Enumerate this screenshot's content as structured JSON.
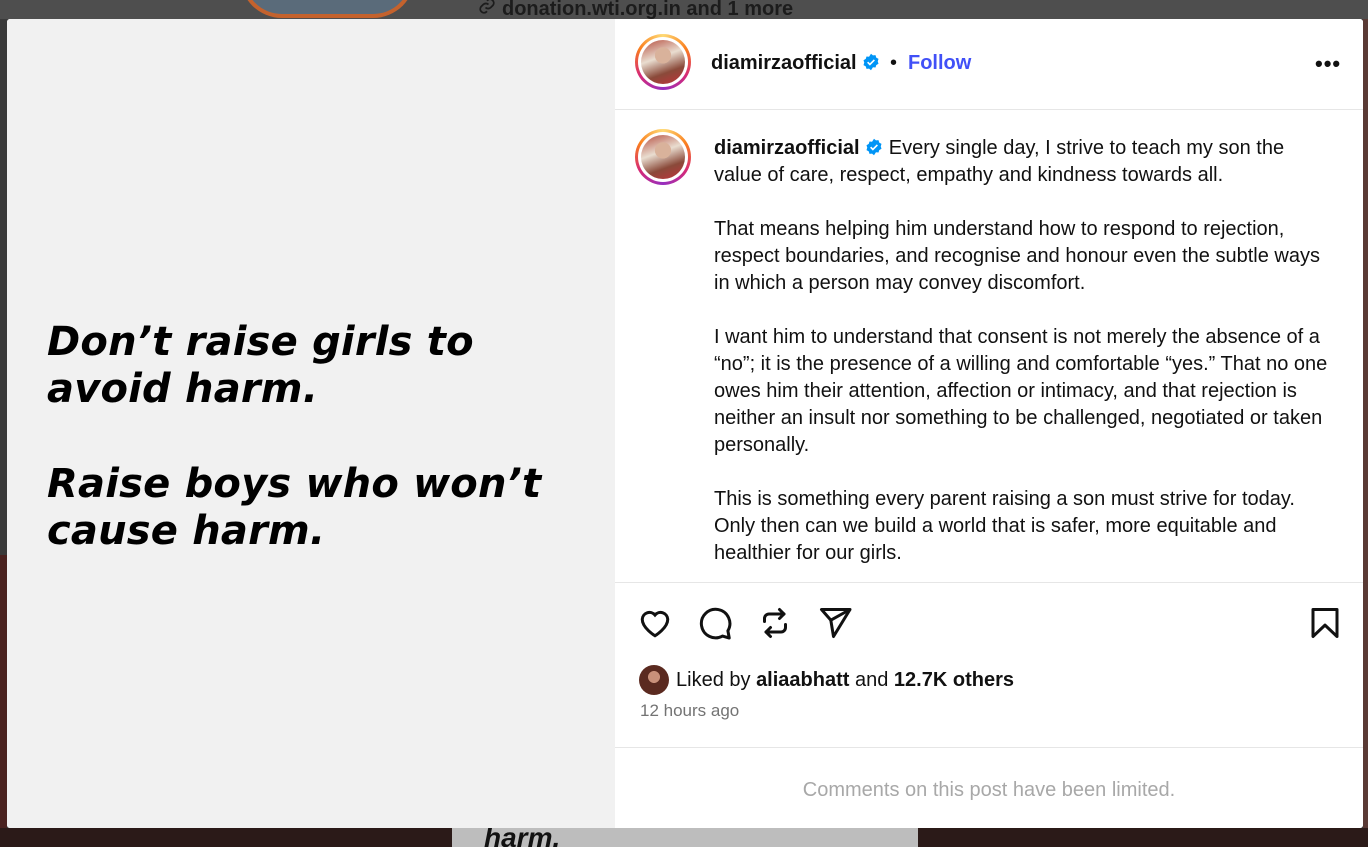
{
  "background": {
    "link_text": "donation.wti.org.in and 1 more",
    "bottom_text": "harm."
  },
  "media": {
    "quote_lines": [
      "Don’t raise girls to avoid harm.",
      "Raise boys who won’t cause harm."
    ]
  },
  "header": {
    "username": "diamirzaofficial",
    "separator": "•",
    "follow_label": "Follow",
    "more_label": "•••"
  },
  "caption": {
    "username": "diamirzaofficial",
    "paragraphs": [
      "Every single day, I strive to teach my son the value of care, respect, empathy and kindness towards all.",
      "That means helping him understand how to respond to rejection, respect boundaries, and recognise and honour even the subtle ways in which a person may convey discomfort.",
      "I want him to understand that consent is not merely the absence of a “no”; it is the presence of a willing and comfortable “yes.” That no one owes him their attention, affection or intimacy, and that rejection is neither an insult nor something to be challenged, negotiated or taken personally.",
      "This is something every parent raising a son must strive for today. Only then can we build a world that is safer, more equitable and healthier for our girls."
    ]
  },
  "actions": {
    "icons": [
      "heart-icon",
      "comment-icon",
      "repost-icon",
      "share-icon",
      "bookmark-icon"
    ]
  },
  "likes": {
    "prefix": "Liked by",
    "liker": "aliaabhatt",
    "middle": "and",
    "count": "12.7K others"
  },
  "time_ago": "12 hours ago",
  "comments_notice": "Comments on this post have been limited.",
  "colors": {
    "follow": "#4150f7",
    "verified": "#0095f6",
    "muted": "#737373"
  }
}
